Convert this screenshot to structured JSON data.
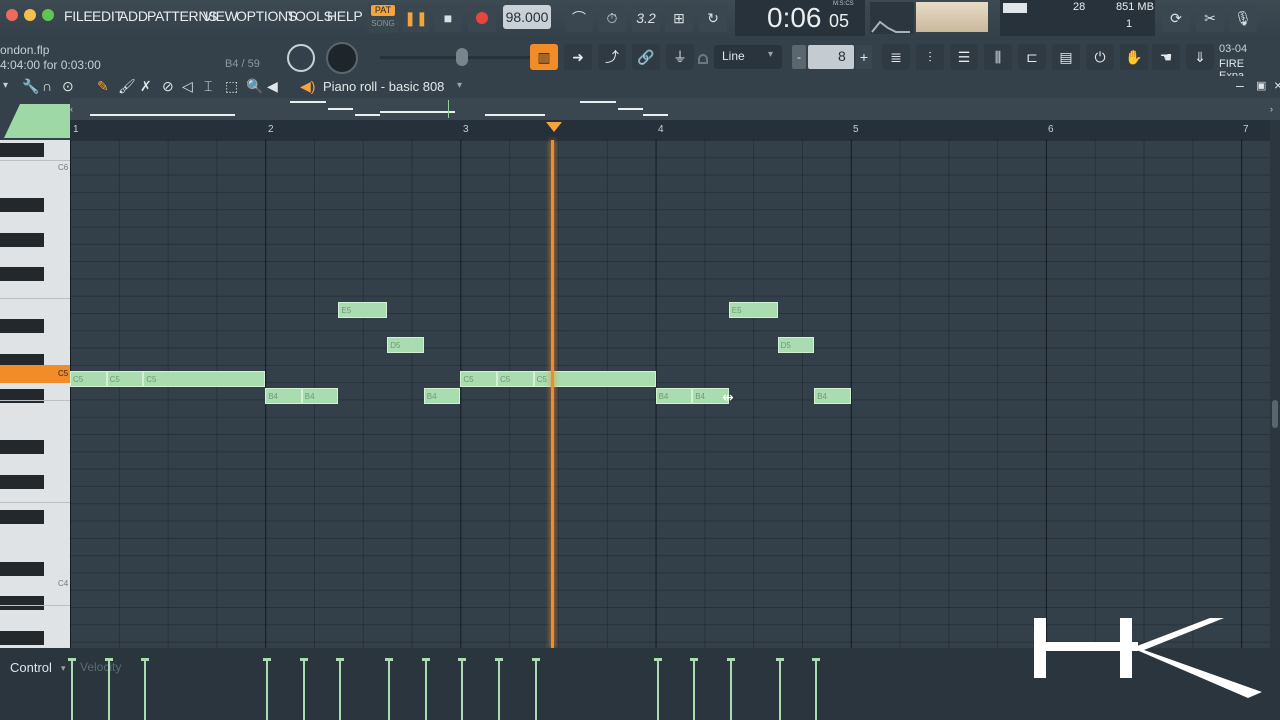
{
  "window": {
    "traffic_lights": [
      "#ec6a5e",
      "#f4bf4f",
      "#61c554"
    ],
    "accent_color": "#f28c28",
    "note_color": "#a9dcae"
  },
  "menu": [
    "FILE",
    "EDIT",
    "ADD",
    "PATTERNS",
    "VIEW",
    "OPTIONS",
    "TOOLS",
    "HELP"
  ],
  "transport": {
    "pat_label": "PAT",
    "song_label": "SONG",
    "tempo": "98.000",
    "time_display": "0:06",
    "time_small": "05",
    "time_unit": "M:S:CS",
    "step_display": "3.2"
  },
  "stats": {
    "cpu": "28",
    "memory": "851 MB",
    "voices": "1"
  },
  "project": {
    "file_name": "ondon.flp",
    "time_info": "4:04:00 for 0:03:00",
    "hint": "B4 / 59"
  },
  "toolbar2": {
    "snap_mode": "Line",
    "step_value": "8",
    "news_date": "03-04",
    "news_text": "FIRE Expa..."
  },
  "piano_roll": {
    "title": "Piano roll - basic 808",
    "ruler_marks": [
      "1",
      "2",
      "3",
      "4",
      "5",
      "6",
      "7"
    ],
    "key_labels": {
      "c6": "C6",
      "c5": "C5",
      "c4": "C4"
    },
    "notes": [
      {
        "label": "C5",
        "bar": 0,
        "beat": 0,
        "len": 0.75
      },
      {
        "label": "C5",
        "bar": 0,
        "beat": 0.75,
        "len": 0.75
      },
      {
        "label": "C5",
        "bar": 0,
        "beat": 1.5,
        "len": 2.5
      },
      {
        "label": "B4",
        "bar": 1,
        "beat": 0,
        "len": 0.75
      },
      {
        "label": "B4",
        "bar": 1,
        "beat": 0.75,
        "len": 0.75
      },
      {
        "label": "E5",
        "bar": 1,
        "beat": 1.5,
        "len": 1.0
      },
      {
        "label": "D5",
        "bar": 1,
        "beat": 2.5,
        "len": 0.75
      },
      {
        "label": "B4",
        "bar": 1,
        "beat": 3.25,
        "len": 0.75
      },
      {
        "label": "C5",
        "bar": 2,
        "beat": 0,
        "len": 0.75
      },
      {
        "label": "C5",
        "bar": 2,
        "beat": 0.75,
        "len": 0.75
      },
      {
        "label": "C5",
        "bar": 2,
        "beat": 1.5,
        "len": 2.5
      },
      {
        "label": "B4",
        "bar": 3,
        "beat": 0,
        "len": 0.75
      },
      {
        "label": "B4",
        "bar": 3,
        "beat": 0.75,
        "len": 0.75
      },
      {
        "label": "E5",
        "bar": 3,
        "beat": 1.5,
        "len": 1.0
      },
      {
        "label": "D5",
        "bar": 3,
        "beat": 2.5,
        "len": 0.75
      },
      {
        "label": "B4",
        "bar": 3,
        "beat": 3.25,
        "len": 0.75
      }
    ],
    "playhead_bar": 3.46
  },
  "control": {
    "label": "Control",
    "target": "Velocity"
  },
  "watermark": "HK"
}
